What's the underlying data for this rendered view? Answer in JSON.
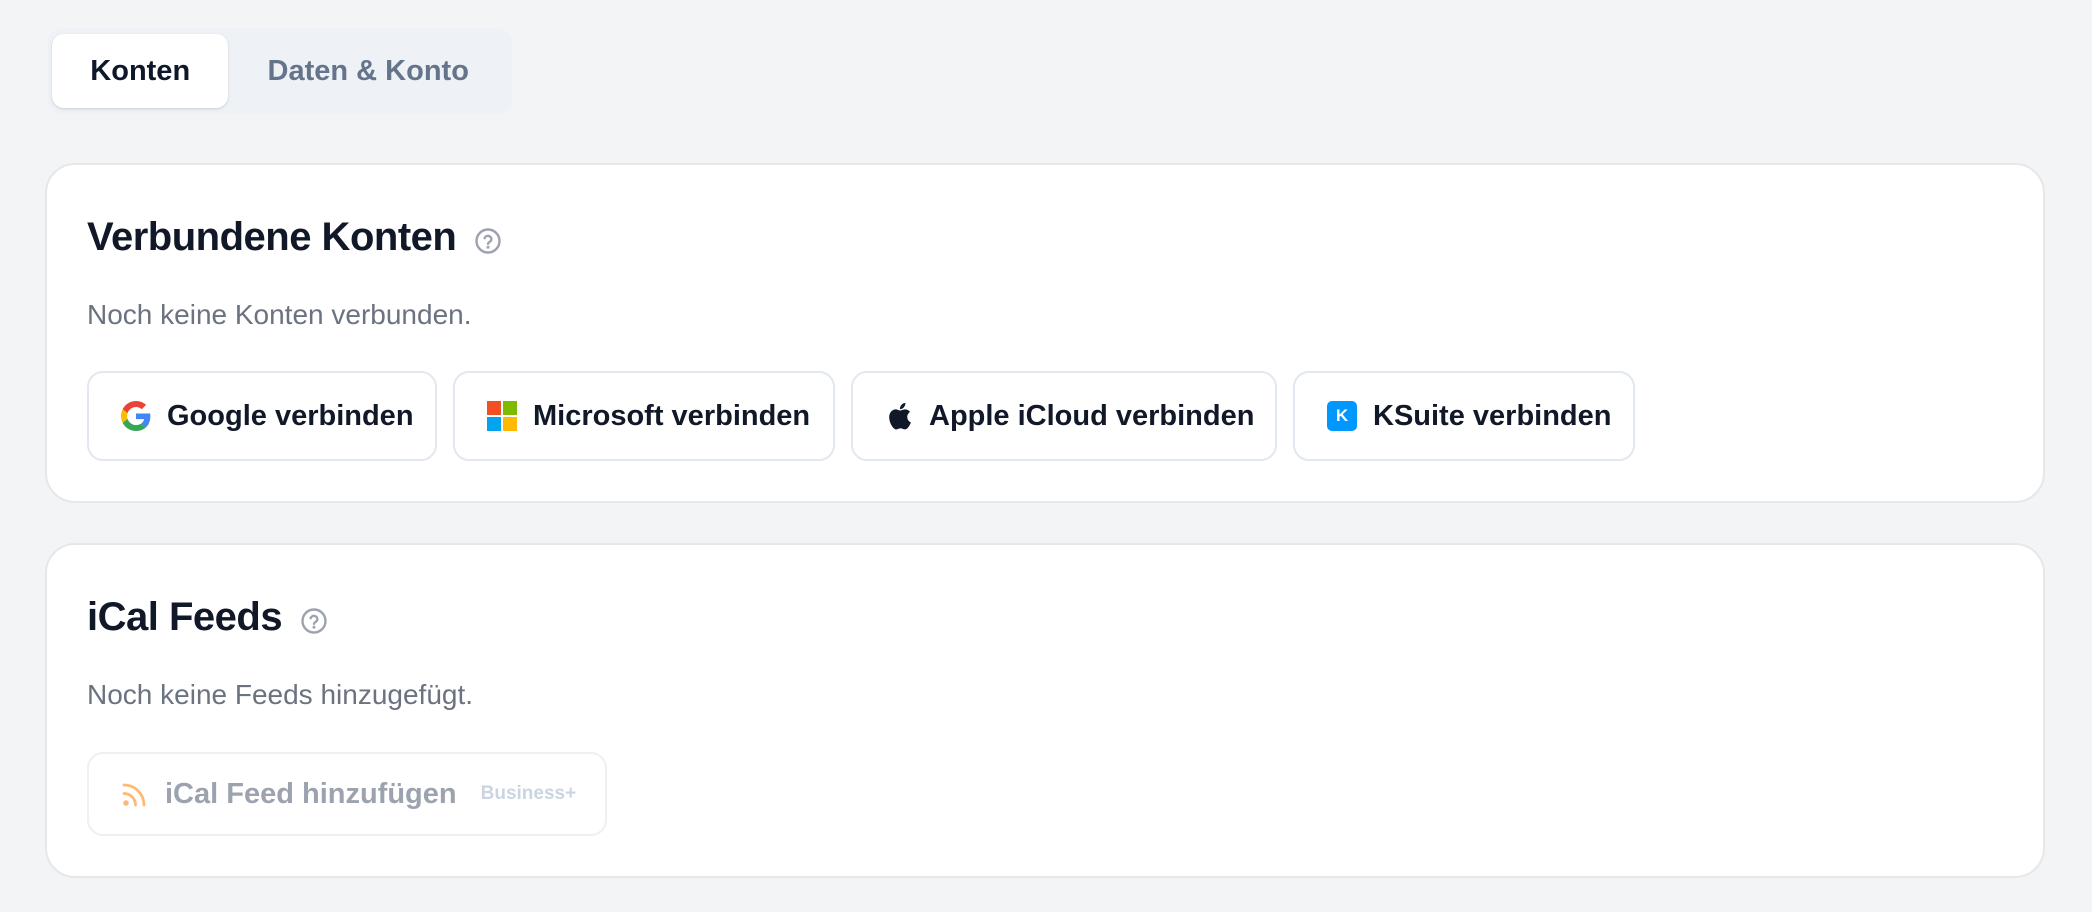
{
  "tabs": [
    {
      "label": "Konten",
      "active": true
    },
    {
      "label": "Daten & Konto",
      "active": false
    }
  ],
  "accounts": {
    "title": "Verbundene Konten",
    "help_icon": "question-circle-icon",
    "description": "Noch keine Konten verbunden.",
    "buttons": [
      {
        "label": "Google verbinden",
        "icon": "google-icon"
      },
      {
        "label": "Microsoft verbinden",
        "icon": "microsoft-icon"
      },
      {
        "label": "Apple iCloud verbinden",
        "icon": "apple-icon"
      },
      {
        "label": "KSuite verbinden",
        "icon": "ksuite-icon",
        "icon_text": "K"
      }
    ]
  },
  "ical": {
    "title": "iCal Feeds",
    "help_icon": "question-circle-icon",
    "description": "Noch keine Feeds hinzugefügt.",
    "add_button": {
      "label": "iCal Feed hinzufügen",
      "icon": "rss-icon",
      "badge": "Business+",
      "disabled": true
    }
  },
  "colors": {
    "background": "#f3f4f6",
    "card": "#ffffff",
    "border": "#e5e7eb",
    "title": "#111827",
    "muted": "#6b7280",
    "tab_inactive": "#64748b",
    "ksuite_blue": "#0098ff",
    "rss_orange": "#fdba74"
  }
}
